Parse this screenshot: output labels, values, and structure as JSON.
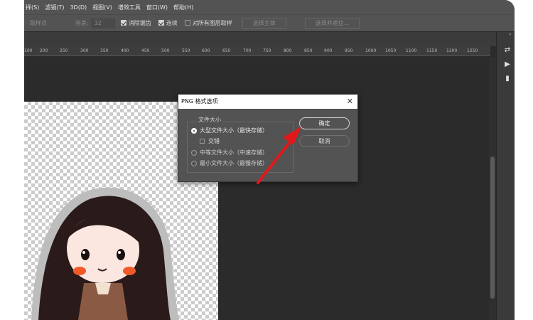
{
  "menu": {
    "items": [
      "择(S)",
      "滤镜(T)",
      "3D(D)",
      "视图(V)",
      "增效工具",
      "窗口(W)",
      "帮助(H)"
    ]
  },
  "options_bar": {
    "sample_point": "取样点",
    "tolerance_label": "容差:",
    "tolerance_value": "32",
    "antialias": "消除锯齿",
    "contiguous": "连续",
    "sample_all_layers": "对所有图层取样",
    "select_subject": "选择主体",
    "select_and_mask": "选择并遮住..."
  },
  "ruler": {
    "ticks": [
      "100",
      "200",
      "250",
      "300",
      "350",
      "400",
      "450",
      "500",
      "550",
      "600",
      "650",
      "700",
      "750",
      "800",
      "850",
      "900",
      "950",
      "1000",
      "1050",
      "1100",
      "1150",
      "1200",
      "1250"
    ]
  },
  "dialog": {
    "title": "PNG 格式选项",
    "group_label": "文件大小",
    "options": [
      "大型文件大小（最快存储）",
      "中等文件大小（中速存储）",
      "最小文件大小（最慢存储）"
    ],
    "interlace": "交错",
    "ok": "确定",
    "cancel": "取消",
    "selected_option": "大型文件大小（最快存储）"
  },
  "colors": {
    "app_bg": "#2b2b2b",
    "menubar_bg": "#535353",
    "dialog_bg": "#535353",
    "annotation_arrow": "#e0191b"
  },
  "icons": {
    "right_panel": [
      "history-icon",
      "play-icon",
      "comment-icon"
    ],
    "close": "close-icon"
  }
}
